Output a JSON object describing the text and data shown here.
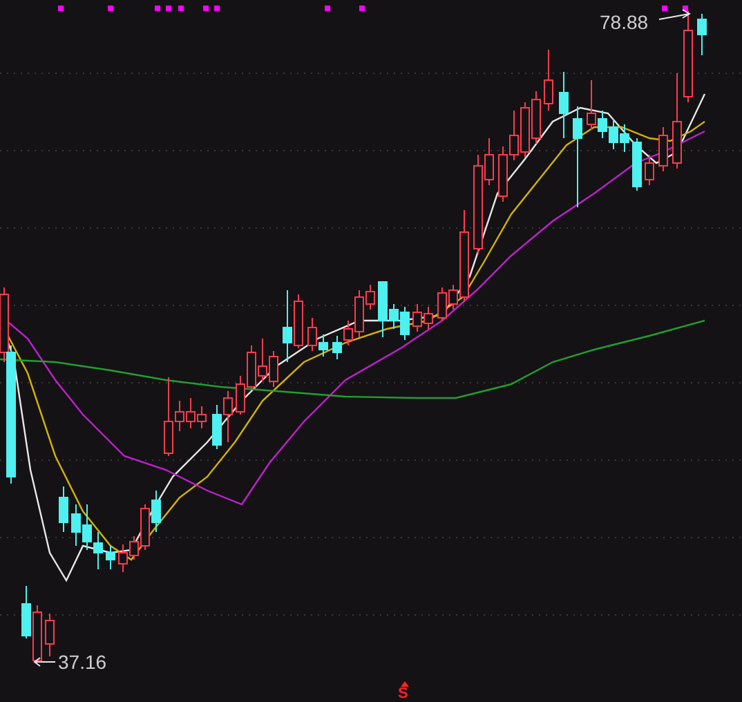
{
  "chart": {
    "high_label": "78.88",
    "low_label": "37.16",
    "signal": "S"
  }
}
